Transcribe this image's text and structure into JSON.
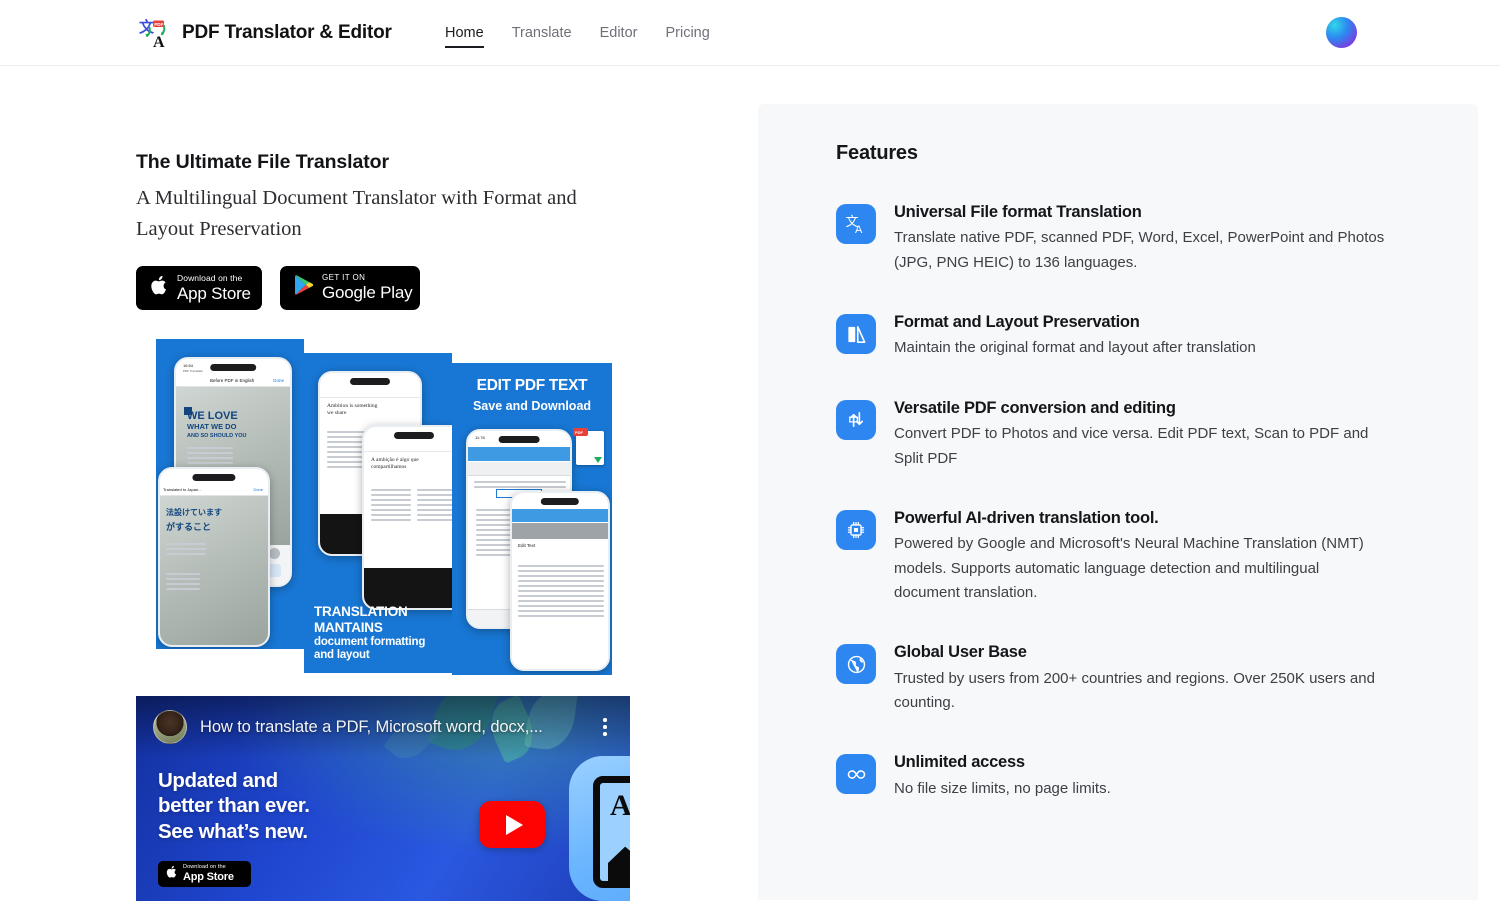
{
  "header": {
    "brand_title": "PDF Translator & Editor",
    "logo_icon": "translate-pdf-logo-icon",
    "nav": [
      {
        "label": "Home",
        "active": true
      },
      {
        "label": "Translate",
        "active": false
      },
      {
        "label": "Editor",
        "active": false
      },
      {
        "label": "Pricing",
        "active": false
      }
    ],
    "avatar_icon": "user-avatar-gradient"
  },
  "hero": {
    "title": "The Ultimate File Translator",
    "subtitle": "A Multilingual Document Translator with Format and Layout Preservation",
    "badges": {
      "apple": {
        "small": "Download on the",
        "big": "App Store",
        "icon": "apple-icon"
      },
      "google": {
        "small": "GET IT ON",
        "big": "Google Play",
        "icon": "google-play-icon"
      }
    }
  },
  "collage": {
    "panel_a": {
      "status_time": "16:54",
      "status_app": "PDF Translator",
      "doc_title": "Before PDF in English",
      "done_label": "Done",
      "headline_1": "WE LOVE",
      "headline_2": "WHAT WE DO",
      "headline_3": "AND SO SHOULD YOU",
      "doc_title_2": "Translated to Japan...",
      "done_label_2": "Done",
      "jp_1": "法設けています",
      "jp_2": "がすること"
    },
    "panel_b": {
      "doc_text": "Ambition is something we share",
      "doc_text_2": "A ambição é algo que compartilhamos",
      "caption_line1": "TRANSLATION",
      "caption_line2": "MANTAINS",
      "caption_line3": "document formatting",
      "caption_line4": "and layout"
    },
    "panel_c": {
      "title": "EDIT PDF TEXT",
      "subtitle": "Save and Download",
      "status_time": "11:78",
      "edit_label": "Edit Text",
      "pdf_tag": "PDF"
    }
  },
  "video": {
    "channel_avatar": "channel-avatar",
    "title": "How to translate a PDF, Microsoft word, docx,...",
    "menu_icon": "kebab-menu-icon",
    "headline_line1": "Updated and",
    "headline_line2": "better than ever.",
    "headline_line3": "See what’s new.",
    "badge": {
      "small": "Download on the",
      "big": "App Store",
      "icon": "apple-icon"
    },
    "play_icon": "youtube-play-icon",
    "app_icon": "app-icon-translate"
  },
  "features": {
    "title": "Features",
    "accent_color": "#2e86f0",
    "panel_background": "#f7f8fa",
    "items": [
      {
        "icon": "translate-icon",
        "title": "Universal File format Translation",
        "desc": "Translate native PDF, scanned PDF, Word, Excel, PowerPoint and Photos (JPG, PNG HEIC) to 136 languages."
      },
      {
        "icon": "flip-layout-icon",
        "title": "Format and Layout Preservation",
        "desc": "Maintain the original format and layout after translation"
      },
      {
        "icon": "convert-arrows-icon",
        "title": "Versatile PDF conversion and editing",
        "desc": "Convert PDF to Photos and vice versa. Edit PDF text, Scan to PDF and Split PDF"
      },
      {
        "icon": "cpu-chip-icon",
        "title": "Powerful AI-driven translation tool.",
        "desc": "Powered by Google and Microsoft's Neural Machine Translation (NMT) models. Supports automatic language detection and multilingual document translation."
      },
      {
        "icon": "globe-icon",
        "title": "Global User Base",
        "desc": "Trusted by users from 200+ countries and regions. Over 250K users and counting."
      },
      {
        "icon": "infinity-icon",
        "title": "Unlimited access",
        "desc": "No file size limits, no page limits."
      }
    ]
  }
}
